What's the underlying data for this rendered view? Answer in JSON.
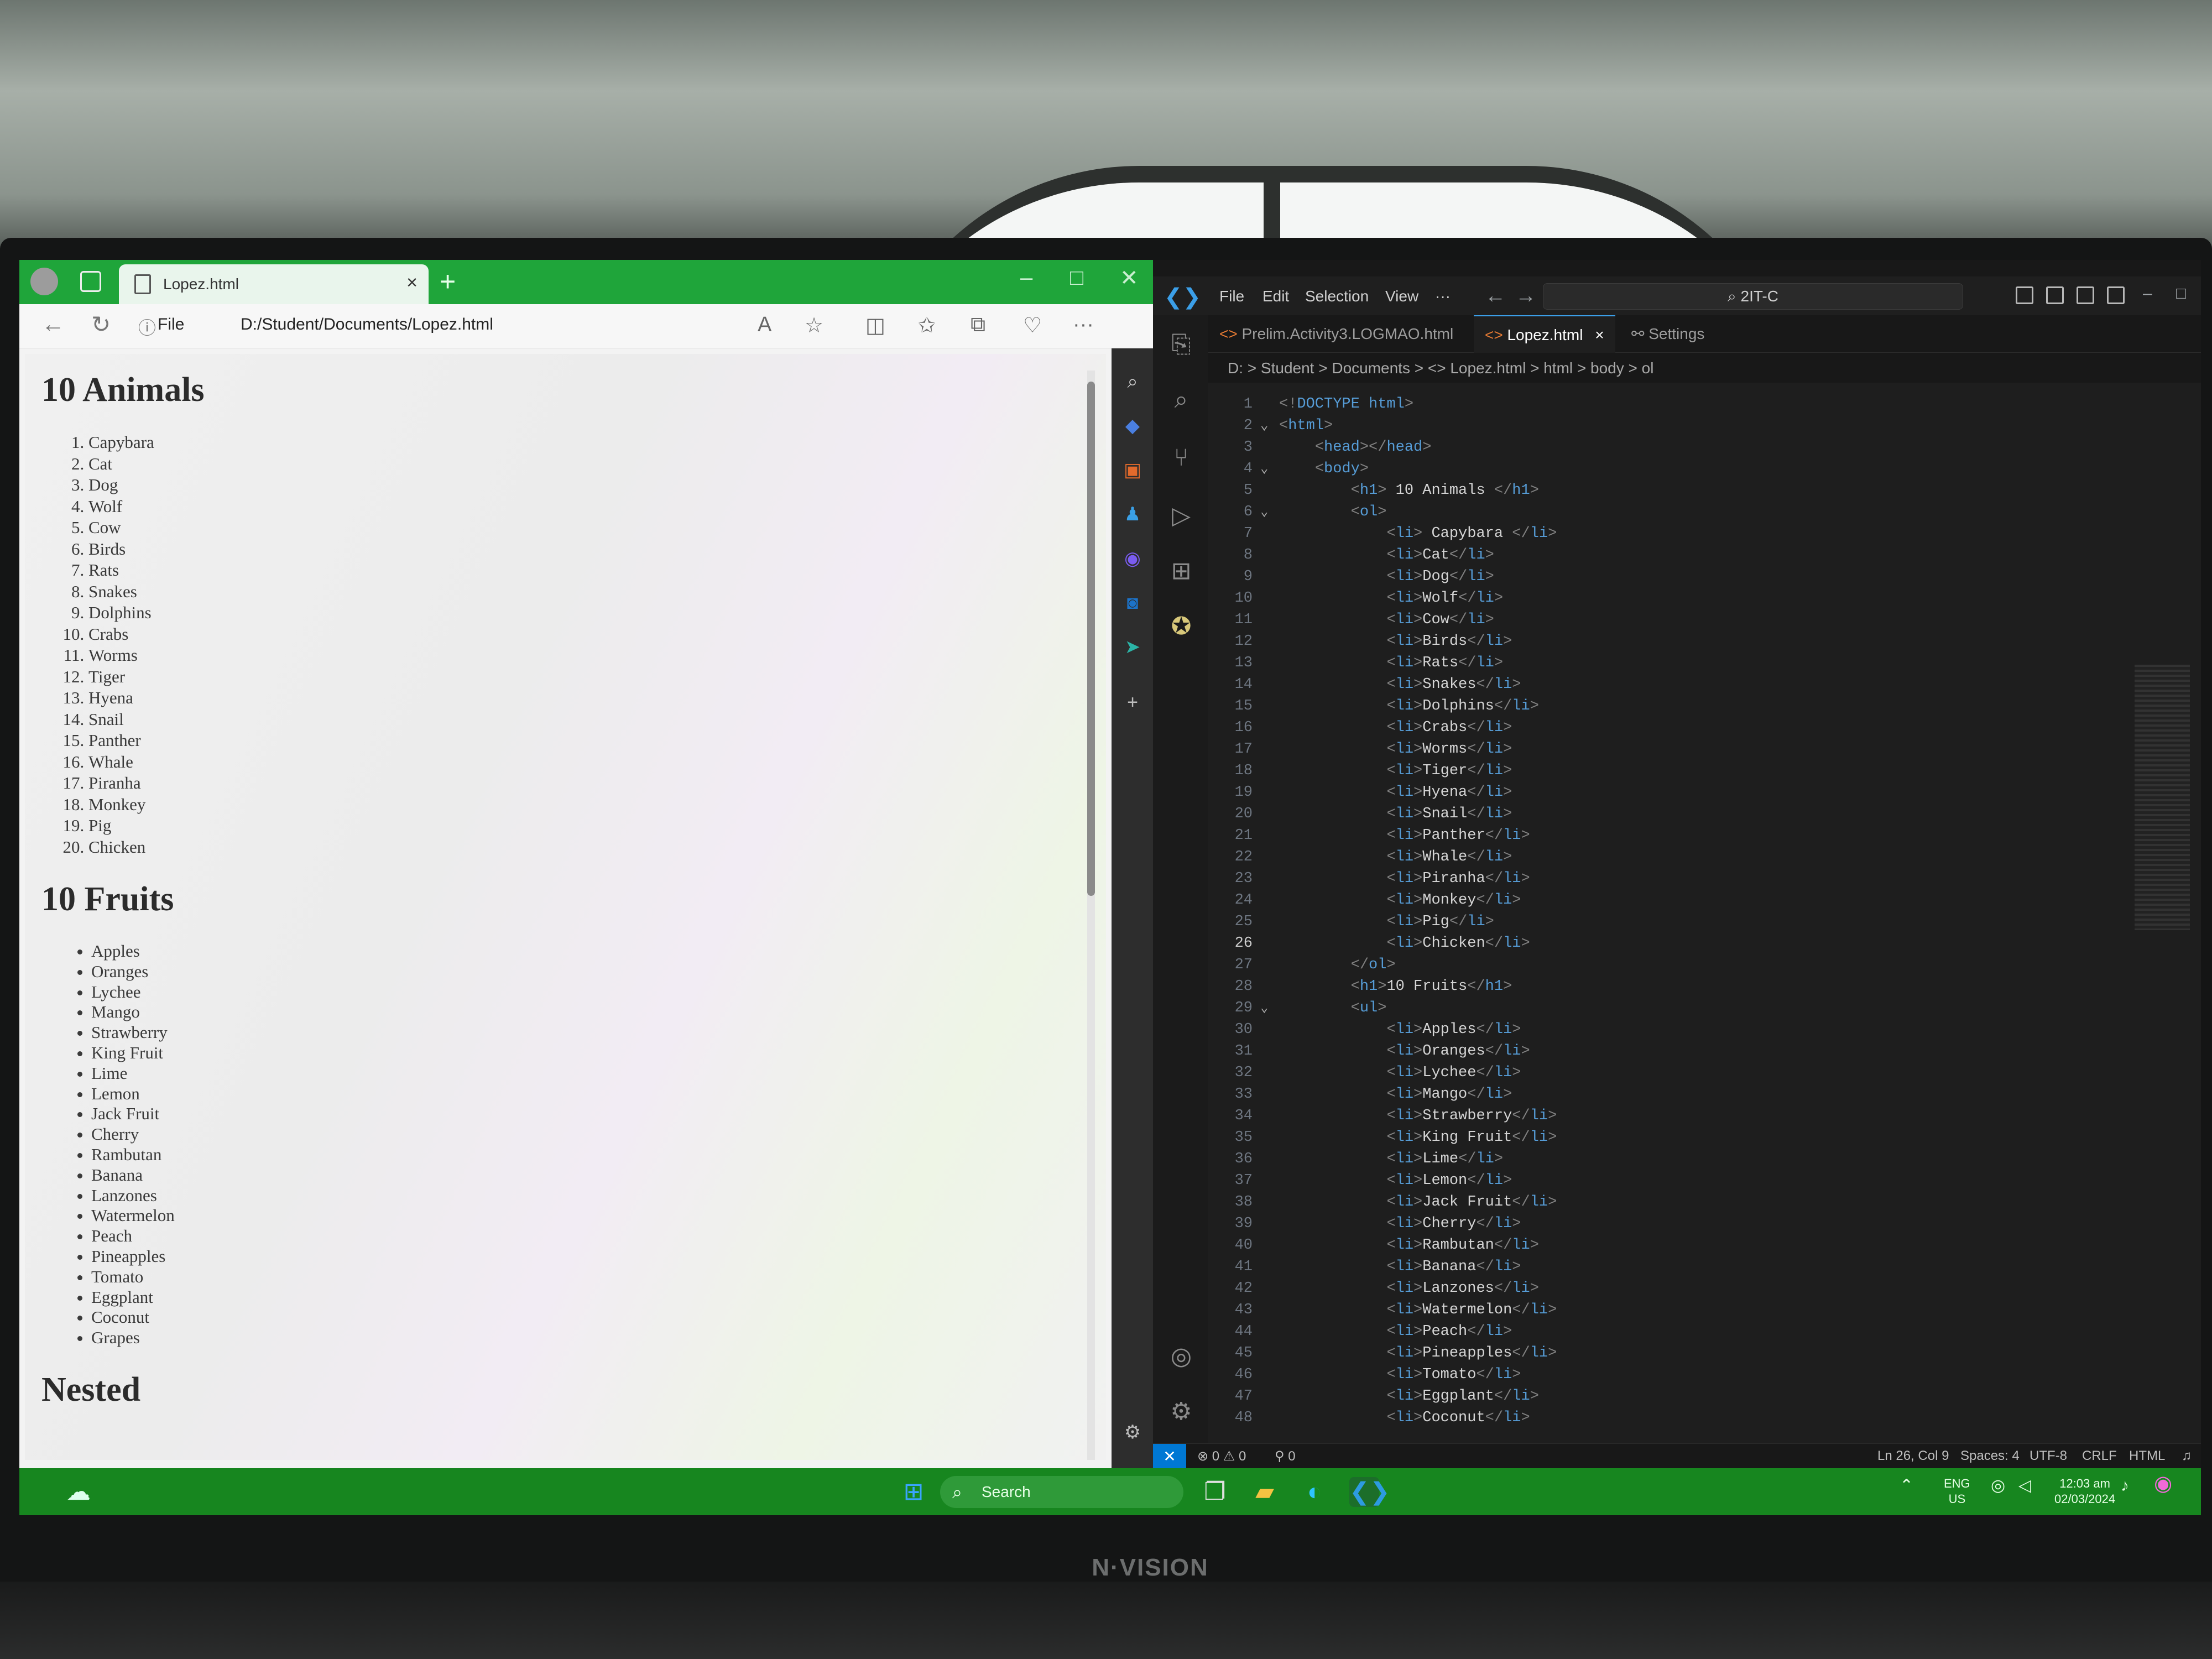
{
  "browser": {
    "tab_title": "Lopez.html",
    "tab_close": "×",
    "new_tab": "+",
    "file_label": "File",
    "url": "D:/Student/Documents/Lopez.html",
    "page": {
      "heading_animals": "10 Animals",
      "animals": [
        "Capybara",
        "Cat",
        "Dog",
        "Wolf",
        "Cow",
        "Birds",
        "Rats",
        "Snakes",
        "Dolphins",
        "Crabs",
        "Worms",
        "Tiger",
        "Hyena",
        "Snail",
        "Panther",
        "Whale",
        "Piranha",
        "Monkey",
        "Pig",
        "Chicken"
      ],
      "heading_fruits": "10 Fruits",
      "fruits": [
        "Apples",
        "Oranges",
        "Lychee",
        "Mango",
        "Strawberry",
        "King Fruit",
        "Lime",
        "Lemon",
        "Jack Fruit",
        "Cherry",
        "Rambutan",
        "Banana",
        "Lanzones",
        "Watermelon",
        "Peach",
        "Pineapples",
        "Tomato",
        "Eggplant",
        "Coconut",
        "Grapes"
      ],
      "heading_nested": "Nested"
    }
  },
  "vscode": {
    "menu": [
      "File",
      "Edit",
      "Selection",
      "View",
      "···"
    ],
    "command_center": "2IT-C",
    "tabs": [
      {
        "label": "Prelim.Activity3.LOGMAO.html",
        "active": false
      },
      {
        "label": "Lopez.html",
        "active": true,
        "close": "×"
      },
      {
        "label": "Settings",
        "active": false
      }
    ],
    "breadcrumbs": "D: > Student > Documents > <> Lopez.html > html > body > ol",
    "current_line": 26,
    "code_lines": [
      "<!DOCTYPE html>",
      "<html>",
      "    <head></head>",
      "    <body>",
      "        <h1> 10 Animals </h1>",
      "        <ol>",
      "            <li> Capybara </li>",
      "            <li>Cat</li>",
      "            <li>Dog</li>",
      "            <li>Wolf</li>",
      "            <li>Cow</li>",
      "            <li>Birds</li>",
      "            <li>Rats</li>",
      "            <li>Snakes</li>",
      "            <li>Dolphins</li>",
      "            <li>Crabs</li>",
      "            <li>Worms</li>",
      "            <li>Tiger</li>",
      "            <li>Hyena</li>",
      "            <li>Snail</li>",
      "            <li>Panther</li>",
      "            <li>Whale</li>",
      "            <li>Piranha</li>",
      "            <li>Monkey</li>",
      "            <li>Pig</li>",
      "            <li>Chicken</li>",
      "        </ol>",
      "        <h1>10 Fruits</h1>",
      "        <ul>",
      "            <li>Apples</li>",
      "            <li>Oranges</li>",
      "            <li>Lychee</li>",
      "            <li>Mango</li>",
      "            <li>Strawberry</li>",
      "            <li>King Fruit</li>",
      "            <li>Lime</li>",
      "            <li>Lemon</li>",
      "            <li>Jack Fruit</li>",
      "            <li>Cherry</li>",
      "            <li>Rambutan</li>",
      "            <li>Banana</li>",
      "            <li>Lanzones</li>",
      "            <li>Watermelon</li>",
      "            <li>Peach</li>",
      "            <li>Pineapples</li>",
      "            <li>Tomato</li>",
      "            <li>Eggplant</li>",
      "            <li>Coconut</li>"
    ],
    "fold_lines": [
      2,
      4,
      6,
      29
    ],
    "status": {
      "problems": "⊗ 0 ⚠ 0",
      "ports": "⚲ 0",
      "position": "Ln 26, Col 9",
      "spaces": "Spaces: 4",
      "encoding": "UTF-8",
      "eol": "CRLF",
      "language": "HTML"
    }
  },
  "taskbar": {
    "search_label": "Search",
    "lang_top": "ENG",
    "lang_bottom": "US",
    "time": "12:03 am",
    "date": "02/03/2024"
  },
  "monitor_brand": "N·VISION",
  "colors": {
    "browser_accent": "#1fa53a",
    "taskbar": "#17861f",
    "vscode_blue": "#0078d4",
    "tag_blue": "#569cd6"
  }
}
